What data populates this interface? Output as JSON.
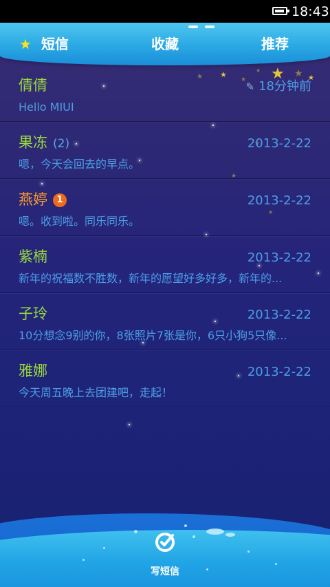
{
  "status_bar": {
    "time": "18:43",
    "battery_level": 0.9
  },
  "tabs": [
    {
      "label": "短信",
      "icon": "star-icon",
      "selected": true
    },
    {
      "label": "收藏",
      "selected": false
    },
    {
      "label": "推荐",
      "selected": false
    }
  ],
  "conversations": [
    {
      "name": "倩倩",
      "preview": "Hello MIUI",
      "date": "18分钟前",
      "draft": true,
      "count": "",
      "unread": ""
    },
    {
      "name": "果冻",
      "count": "(2)",
      "preview": "嗯，今天会回去的早点。",
      "date": "2013-2-22",
      "unread": ""
    },
    {
      "name": "燕婷",
      "unread": "1",
      "preview": "嗯。收到啦。同乐同乐。",
      "date": "2013-2-22",
      "count": ""
    },
    {
      "name": "紫楠",
      "preview": "新年的祝福数不胜数，新年的愿望好多好多，新年的...",
      "date": "2013-2-22",
      "count": "",
      "unread": ""
    },
    {
      "name": "子玲",
      "preview": "10分想念9别的你，8张照片7张是你，6只小狗5只像...",
      "date": "2013-2-22",
      "count": "",
      "unread": ""
    },
    {
      "name": "雅娜",
      "preview": "今天周五晚上去团建吧，走起！",
      "date": "2013-2-22",
      "count": "",
      "unread": ""
    }
  ],
  "compose": {
    "label": "写短信",
    "icon": "compose-icon"
  },
  "colors": {
    "name_green": "#9bd93c",
    "name_orange": "#ff9a2e",
    "text_blue": "#4d9ee6",
    "tab_bar": "#2aa8e4",
    "badge": "#f06a1c",
    "star": "#ffe21a"
  }
}
